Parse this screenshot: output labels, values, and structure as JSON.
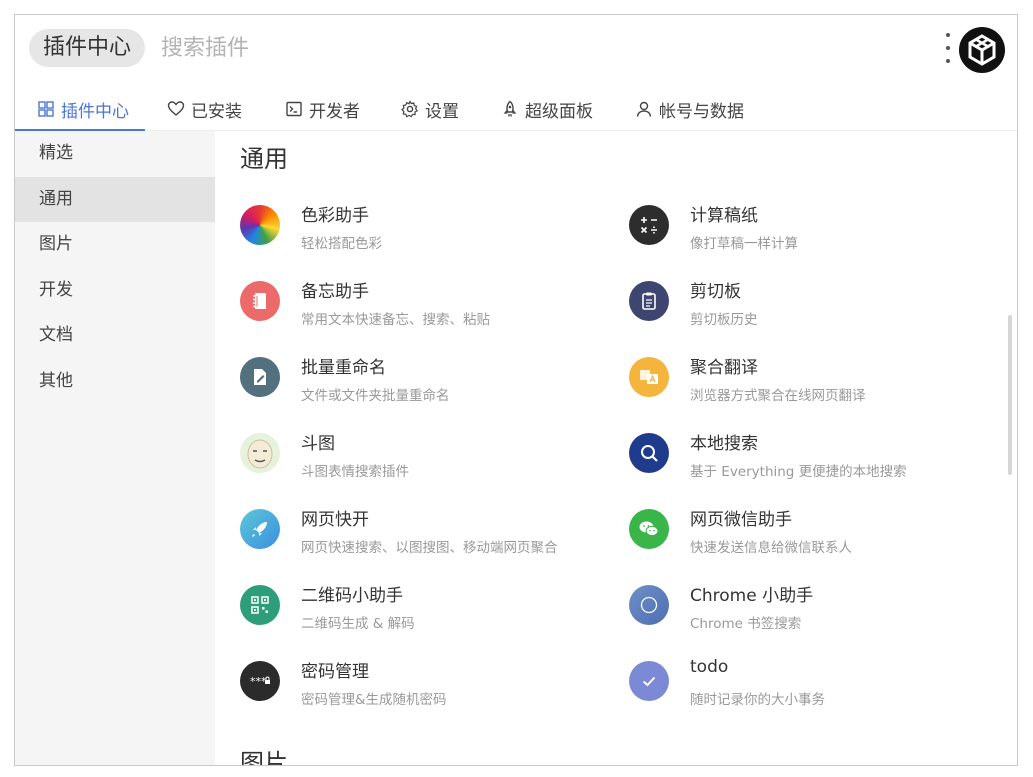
{
  "header": {
    "tag_label": "插件中心",
    "search_placeholder": "搜索插件"
  },
  "tabs": [
    {
      "label": "插件中心",
      "icon": "grid-icon",
      "active": true
    },
    {
      "label": "已安装",
      "icon": "heart-icon",
      "active": false
    },
    {
      "label": "开发者",
      "icon": "terminal-icon",
      "active": false
    },
    {
      "label": "设置",
      "icon": "gear-icon",
      "active": false
    },
    {
      "label": "超级面板",
      "icon": "rocket-icon",
      "active": false
    },
    {
      "label": "帐号与数据",
      "icon": "user-icon",
      "active": false
    }
  ],
  "sidebar": {
    "items": [
      {
        "label": "精选",
        "active": false
      },
      {
        "label": "通用",
        "active": true
      },
      {
        "label": "图片",
        "active": false
      },
      {
        "label": "开发",
        "active": false
      },
      {
        "label": "文档",
        "active": false
      },
      {
        "label": "其他",
        "active": false
      }
    ]
  },
  "sections": [
    {
      "title": "通用"
    },
    {
      "title": "图片"
    }
  ],
  "plugins": [
    {
      "name": "色彩助手",
      "desc": "轻松搭配色彩",
      "icon": "color-wheel-icon"
    },
    {
      "name": "计算稿纸",
      "desc": "像打草稿一样计算",
      "icon": "calculator-icon"
    },
    {
      "name": "备忘助手",
      "desc": "常用文本快速备忘、搜索、粘贴",
      "icon": "notebook-icon"
    },
    {
      "name": "剪切板",
      "desc": "剪切板历史",
      "icon": "clipboard-icon"
    },
    {
      "name": "批量重命名",
      "desc": "文件或文件夹批量重命名",
      "icon": "rename-icon"
    },
    {
      "name": "聚合翻译",
      "desc": "浏览器方式聚合在线网页翻译",
      "icon": "translate-icon"
    },
    {
      "name": "斗图",
      "desc": "斗图表情搜索插件",
      "icon": "meme-face-icon"
    },
    {
      "name": "本地搜索",
      "desc": "基于 Everything 更便捷的本地搜索",
      "icon": "magnifier-icon"
    },
    {
      "name": "网页快开",
      "desc": "网页快速搜索、以图搜图、移动端网页聚合",
      "icon": "rocket-icon"
    },
    {
      "name": "网页微信助手",
      "desc": "快速发送信息给微信联系人",
      "icon": "wechat-icon"
    },
    {
      "name": "二维码小助手",
      "desc": "二维码生成 & 解码",
      "icon": "qrcode-icon"
    },
    {
      "name": "Chrome 小助手",
      "desc": "Chrome 书签搜索",
      "icon": "chrome-icon"
    },
    {
      "name": "密码管理",
      "desc": "密码管理&生成随机密码",
      "icon": "password-icon"
    },
    {
      "name": "todo",
      "desc": "随时记录你的大小事务",
      "icon": "check-icon"
    }
  ],
  "colors": {
    "accent": "#4a76d4",
    "sidebar_bg": "#f5f5f5",
    "sidebar_active": "#e3e3e3"
  }
}
